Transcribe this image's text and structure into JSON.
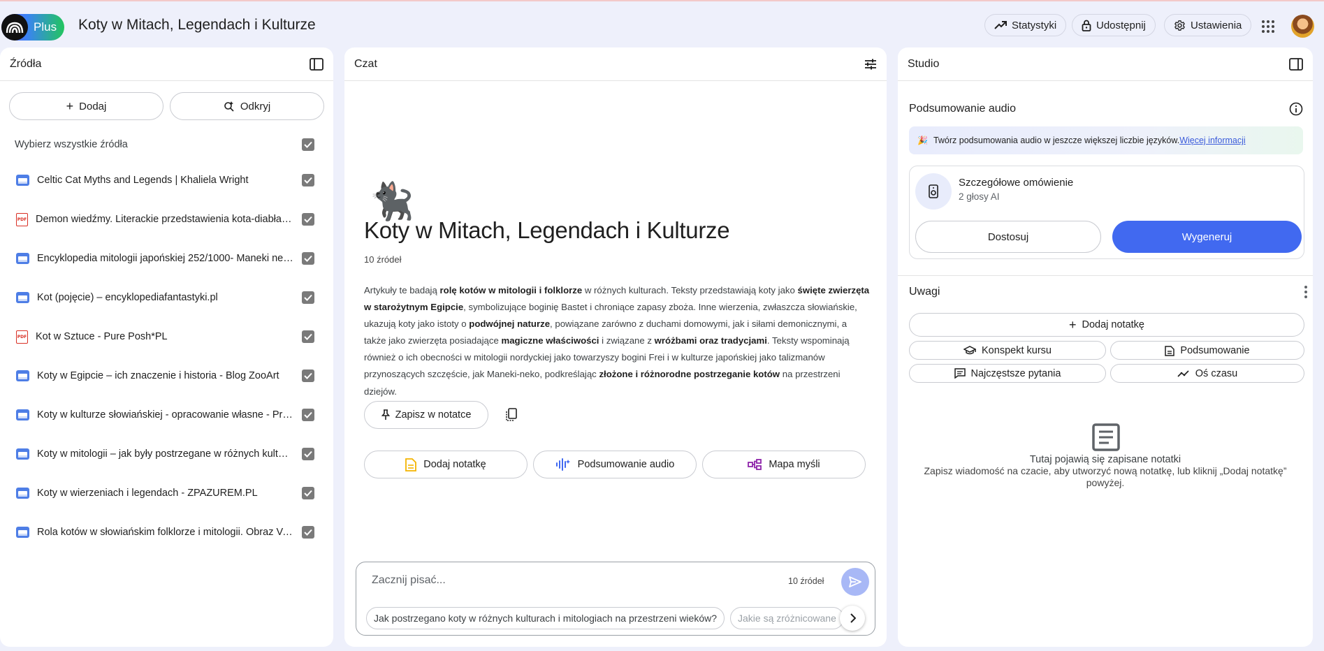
{
  "app": {
    "brand": "Plus",
    "title": "Koty w Mitach, Legendach i Kulturze"
  },
  "header": {
    "stats": "Statystyki",
    "share": "Udostępnij",
    "settings": "Ustawienia"
  },
  "sources": {
    "title": "Źródła",
    "add": "Dodaj",
    "discover": "Odkryj",
    "select_all": "Wybierz wszystkie źródła",
    "items": [
      {
        "type": "web",
        "label": "Celtic Cat Myths and Legends | Khaliela Wright"
      },
      {
        "type": "pdf",
        "label": "Demon wiedźmy. Literackie przedstawienia kota-diabła i..."
      },
      {
        "type": "web",
        "label": "Encyklopedia mitologii japońskiej 252/1000- Maneki nek..."
      },
      {
        "type": "web",
        "label": "Kot (pojęcie) – encyklopediafantastyki.pl"
      },
      {
        "type": "pdf",
        "label": "Kot w Sztuce - Pure Posh*PL"
      },
      {
        "type": "web",
        "label": "Koty w Egipcie – ich znaczenie i historia - Blog ZooArt"
      },
      {
        "type": "web",
        "label": "Koty w kulturze słowiańskiej - opracowanie własne - Prit..."
      },
      {
        "type": "web",
        "label": "Koty w mitologii – jak były postrzegane w różnych kultur..."
      },
      {
        "type": "web",
        "label": "Koty w wierzeniach i legendach - ZPAZUREM.PL"
      },
      {
        "type": "web",
        "label": "Rola kotów w słowiańskim folklorze i mitologii. Obraz Vas..."
      }
    ]
  },
  "chat": {
    "title": "Czat",
    "emoji": "🐈‍⬛",
    "notebook_title": "Koty w Mitach, Legendach i Kulturze",
    "source_count": "10 źródeł",
    "summary": [
      {
        "t": "Artykuły te badają ",
        "b": false
      },
      {
        "t": "rolę kotów w mitologii i folklorze",
        "b": true
      },
      {
        "t": " w różnych kulturach. Teksty przedstawiają koty jako ",
        "b": false
      },
      {
        "t": "święte zwierzęta w starożytnym Egipcie",
        "b": true
      },
      {
        "t": ", symbolizujące boginię Bastet i chroniące zapasy zboża. Inne wierzenia, zwłaszcza słowiańskie, ukazują koty jako istoty o ",
        "b": false
      },
      {
        "t": "podwójnej naturze",
        "b": true
      },
      {
        "t": ", powiązane zarówno z duchami domowymi, jak i siłami demonicznymi, a także jako zwierzęta posiadające ",
        "b": false
      },
      {
        "t": "magiczne właściwości",
        "b": true
      },
      {
        "t": " i związane z ",
        "b": false
      },
      {
        "t": "wróżbami oraz tradycjami",
        "b": true
      },
      {
        "t": ". Teksty wspominają również o ich obecności w mitologii nordyckiej jako towarzyszy bogini Frei i w kulturze japońskiej jako talizmanów przynoszących szczęście, jak Maneki-neko, podkreślając ",
        "b": false
      },
      {
        "t": "złożone i różnorodne postrzeganie kotów",
        "b": true
      },
      {
        "t": " na przestrzeni dziejów.",
        "b": false
      }
    ],
    "save_note": "Zapisz w notatce",
    "actions": {
      "add_note": "Dodaj notatkę",
      "audio": "Podsumowanie audio",
      "mindmap": "Mapa myśli"
    },
    "input_placeholder": "Zacznij pisać...",
    "input_count": "10 źródeł",
    "suggestions": [
      "Jak postrzegano koty w różnych kulturach i mitologiach na przestrzeni wieków?",
      "Jakie są zróżnicowane"
    ]
  },
  "studio": {
    "title": "Studio",
    "audio_title": "Podsumowanie audio",
    "banner_text": "Twórz podsumowania audio w jeszcze większej liczbie języków.",
    "banner_link": "Więcej informacji",
    "card_name": "Szczegółowe omówienie",
    "card_sub": "2 głosy AI",
    "customize": "Dostosuj",
    "generate": "Wygeneruj",
    "notes_title": "Uwagi",
    "add_note": "Dodaj notatkę",
    "note_types": [
      "Konspekt kursu",
      "Podsumowanie",
      "Najczęstsze pytania",
      "Oś czasu"
    ],
    "empty_title": "Tutaj pojawią się zapisane notatki",
    "empty_sub": "Zapisz wiadomość na czacie, aby utworzyć nową notatkę, lub kliknij „Dodaj notatkę” powyżej."
  },
  "colors": {
    "accent": "#4169f0",
    "page_bg": "#eef0fb",
    "pdf_red": "#d93025",
    "web_blue": "#4e7ee6"
  }
}
